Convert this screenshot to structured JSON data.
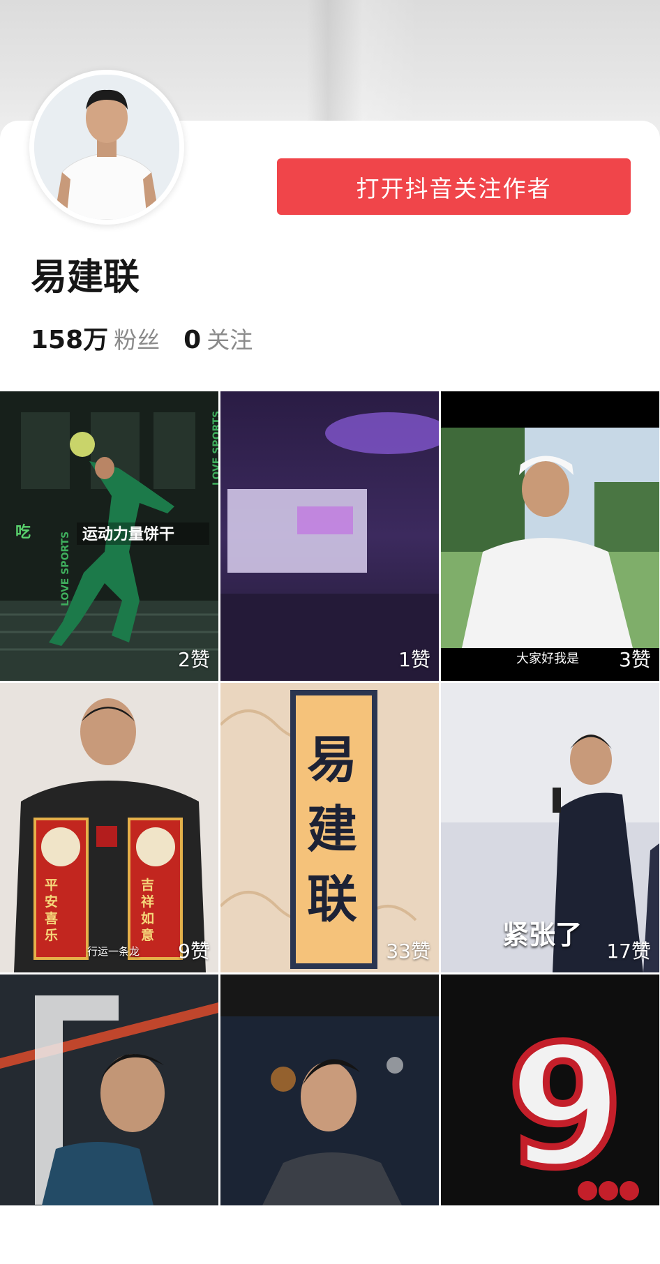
{
  "profile": {
    "name": "易建联",
    "open_button": "打开抖音关注作者",
    "followers_count": "158万",
    "followers_label": "粉丝",
    "following_count": "0",
    "following_label": "关注"
  },
  "colors": {
    "accent": "#f0454a",
    "muted_text": "#8a8a8a"
  },
  "videos": [
    {
      "likes": "2赞",
      "caption_line1": "运动力量饼干",
      "side_text": "LOVE SPORTS"
    },
    {
      "likes": "1赞"
    },
    {
      "likes": "3赞",
      "subtitle": "大家好我是"
    },
    {
      "likes": "9赞",
      "couplet_left": "平安喜乐",
      "couplet_right": "吉祥如意",
      "small_caption": "行运一条龙"
    },
    {
      "likes": "33赞",
      "big_text": "易建联"
    },
    {
      "likes": "17赞",
      "subtitle": "紧张了"
    },
    {},
    {},
    {
      "number": "9"
    }
  ]
}
